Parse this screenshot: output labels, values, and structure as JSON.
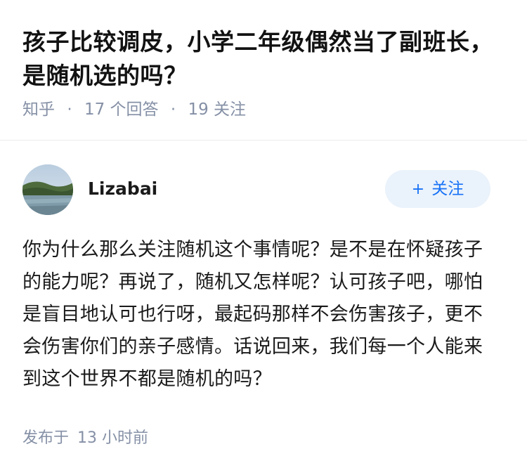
{
  "question": {
    "title": "孩子比较调皮，小学二年级偶然当了副班长，是随机选的吗？",
    "source": "知乎",
    "answer_count": "17 个回答",
    "follower_count": "19 关注",
    "separator": "·"
  },
  "answer": {
    "author": {
      "name": "Lizabai",
      "avatar_icon": "landscape-avatar"
    },
    "follow_button": {
      "plus": "+",
      "label": "关注"
    },
    "content": "你为什么那么关注随机这个事情呢？是不是在怀疑孩子的能力呢？再说了，随机又怎样呢？认可孩子吧，哪怕是盲目地认可也行呀，最起码那样不会伤害孩子，更不会伤害你们的亲子感情。话说回来，我们每一个人能来到这个世界不都是随机的吗？",
    "published_label": "发布于",
    "published_time": "13 小时前"
  },
  "colors": {
    "meta_gray": "#8590a6",
    "accent_blue": "#1772f6",
    "button_bg": "#eaf2fb"
  }
}
